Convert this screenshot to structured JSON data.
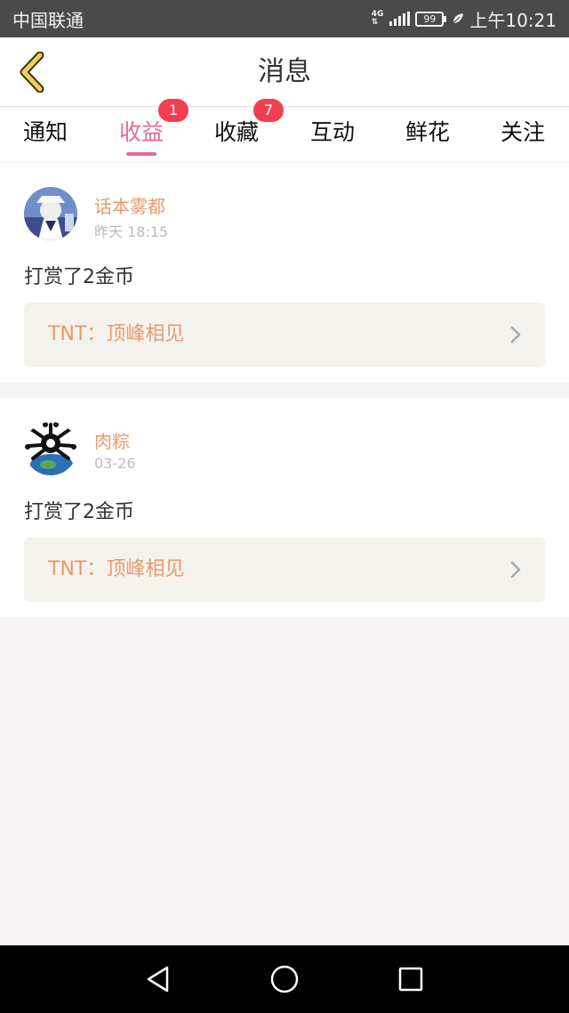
{
  "status_bar": {
    "carrier": "中国联通",
    "network": "4G",
    "battery": "99",
    "time": "上午10:21"
  },
  "header": {
    "title": "消息",
    "back_icon": "back-chevron-icon"
  },
  "tabs": [
    {
      "label": "通知",
      "badge": "",
      "active": false
    },
    {
      "label": "收益",
      "badge": "1",
      "active": true
    },
    {
      "label": "收藏",
      "badge": "7",
      "active": false
    },
    {
      "label": "互动",
      "badge": "",
      "active": false
    },
    {
      "label": "鲜花",
      "badge": "",
      "active": false
    },
    {
      "label": "关注",
      "badge": "",
      "active": false
    }
  ],
  "messages": [
    {
      "user": "话本雾都",
      "time": "昨天 18:15",
      "text": "打赏了2金币",
      "work": "TNT：顶峰相见"
    },
    {
      "user": "肉粽",
      "time": "03-26",
      "text": "打赏了2金币",
      "work": "TNT：顶峰相见"
    }
  ],
  "colors": {
    "accent": "#e3699e",
    "badge": "#f04050",
    "name": "#e89a6e"
  },
  "nav_bar": {
    "icons": [
      "back-triangle-icon",
      "home-circle-icon",
      "recents-square-icon"
    ]
  }
}
